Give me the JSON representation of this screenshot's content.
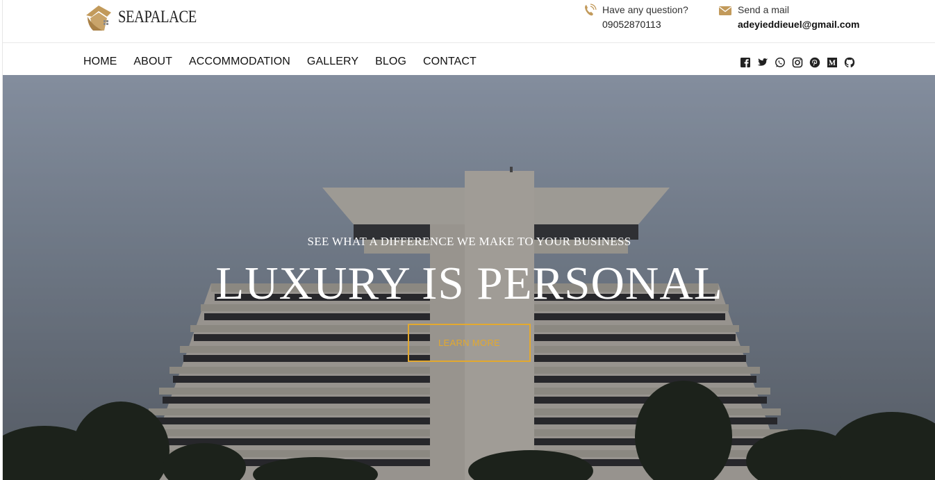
{
  "brand": {
    "name": "SEAPALACE",
    "accent": "#c29a5b"
  },
  "contact": {
    "phone_label": "Have any question?",
    "phone_value": "09052870113",
    "mail_label": "Send a mail",
    "mail_value": "adeyieddieuel@gmail.com"
  },
  "nav": {
    "items": [
      "HOME",
      "ABOUT",
      "ACCOMMODATION",
      "GALLERY",
      "BLOG",
      "CONTACT"
    ]
  },
  "social": {
    "icons": [
      "facebook-icon",
      "twitter-icon",
      "whatsapp-icon",
      "instagram-icon",
      "pinterest-icon",
      "medium-icon",
      "github-icon"
    ]
  },
  "hero": {
    "subtitle": "SEE WHAT A DIFFERENCE WE MAKE TO YOUR BUSINESS",
    "title": "LUXURY IS PERSONAL",
    "button_label": "LEARN MORE",
    "button_color": "#e3a92f"
  }
}
